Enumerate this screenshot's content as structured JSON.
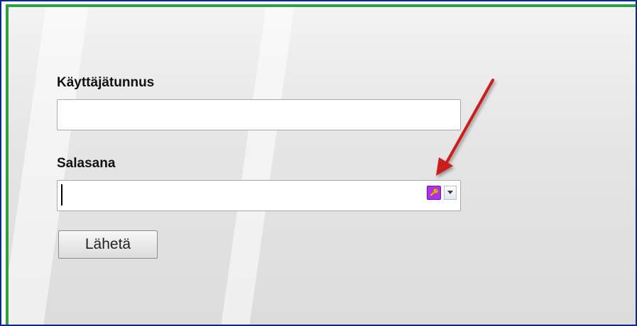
{
  "form": {
    "username_label": "Käyttäjätunnus",
    "username_value": "",
    "password_label": "Salasana",
    "password_value": "",
    "submit_label": "Lähetä"
  },
  "icons": {
    "password_manager": "key-icon",
    "dropdown": "chevron-down-icon",
    "annotation": "red-arrow"
  },
  "colors": {
    "frame_border": "#0a2a8c",
    "accent_border": "#2e9e47",
    "key_button": "#b030f0",
    "key_glyph": "#f5c400",
    "arrow": "#cc1a1a"
  }
}
